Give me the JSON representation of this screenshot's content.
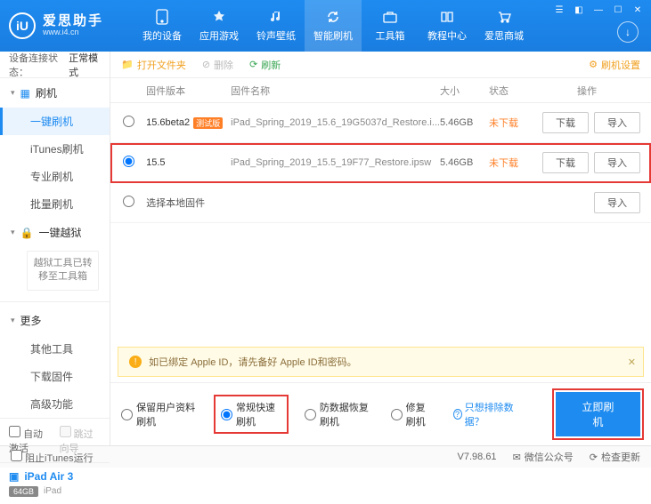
{
  "brand": {
    "cn": "爱思助手",
    "en": "www.i4.cn",
    "logo": "iU"
  },
  "nav": [
    {
      "label": "我的设备"
    },
    {
      "label": "应用游戏"
    },
    {
      "label": "铃声壁纸"
    },
    {
      "label": "智能刷机"
    },
    {
      "label": "工具箱"
    },
    {
      "label": "教程中心"
    },
    {
      "label": "爱思商城"
    }
  ],
  "connection": {
    "label": "设备连接状态：",
    "value": "正常模式"
  },
  "sidebar": {
    "flash": {
      "title": "刷机",
      "items": [
        "一键刷机",
        "iTunes刷机",
        "专业刷机",
        "批量刷机"
      ]
    },
    "jailbreak": {
      "title": "一键越狱",
      "note": "越狱工具已转移至工具箱"
    },
    "more": {
      "title": "更多",
      "items": [
        "其他工具",
        "下载固件",
        "高级功能"
      ]
    }
  },
  "auto": {
    "activate": "自动激活",
    "skip": "跳过向导"
  },
  "device": {
    "name": "iPad Air 3",
    "storage": "64GB",
    "type": "iPad"
  },
  "toolbar": {
    "open": "打开文件夹",
    "delete": "删除",
    "refresh": "刷新",
    "settings": "刷机设置"
  },
  "columns": {
    "ver": "固件版本",
    "name": "固件名称",
    "size": "大小",
    "status": "状态",
    "ops": "操作"
  },
  "rows": [
    {
      "ver": "15.6beta2",
      "tag": "测试版",
      "name": "iPad_Spring_2019_15.6_19G5037d_Restore.i...",
      "size": "5.46GB",
      "status": "未下载",
      "selected": false
    },
    {
      "ver": "15.5",
      "tag": "",
      "name": "iPad_Spring_2019_15.5_19F77_Restore.ipsw",
      "size": "5.46GB",
      "status": "未下载",
      "selected": true
    }
  ],
  "local_row": "选择本地固件",
  "btns": {
    "download": "下载",
    "import": "导入"
  },
  "warning": "如已绑定 Apple ID，请先备好 Apple ID和密码。",
  "modes": {
    "keep": "保留用户资料刷机",
    "normal": "常规快速刷机",
    "antirecover": "防数据恢复刷机",
    "repair": "修复刷机",
    "exclude": "只想排除数据？"
  },
  "flash_btn": "立即刷机",
  "footer": {
    "block": "阻止iTunes运行",
    "version": "V7.98.61",
    "wechat": "微信公众号",
    "update": "检查更新"
  }
}
